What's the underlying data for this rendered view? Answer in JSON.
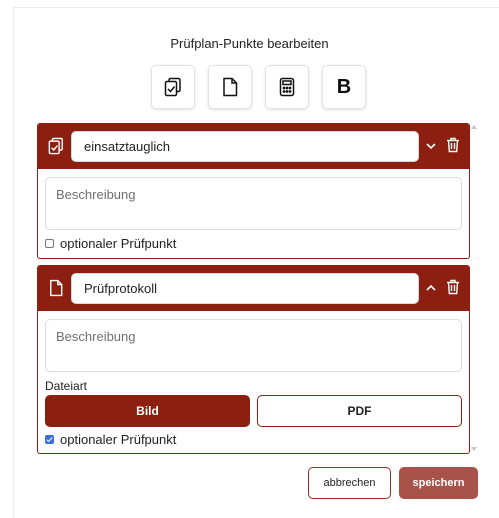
{
  "dialog": {
    "title": "Prüfplan-Punkte bearbeiten"
  },
  "toolbar": {
    "buttons": [
      {
        "icon": "clipboard-check-icon"
      },
      {
        "icon": "file-icon"
      },
      {
        "icon": "calculator-icon"
      },
      {
        "icon": "bold-icon",
        "label": "B"
      }
    ]
  },
  "items": [
    {
      "icon": "clipboard-check-icon",
      "name": "einsatztauglich",
      "expanded": false,
      "description_placeholder": "Beschreibung",
      "optional_label": "optionaler Prüfpunkt",
      "optional_checked": false
    },
    {
      "icon": "file-icon",
      "name": "Prüfprotokoll",
      "expanded": true,
      "description_placeholder": "Beschreibung",
      "file_type_label": "Dateiart",
      "file_type_options": [
        "Bild",
        "PDF"
      ],
      "file_type_selected": "Bild",
      "optional_label": "optionaler Prüfpunkt",
      "optional_checked": true
    }
  ],
  "footer": {
    "cancel_label": "abbrechen",
    "save_label": "speichern"
  },
  "colors": {
    "accent": "#8c1f10",
    "save_button": "#a9524a",
    "checkbox": "#3b6fd4"
  }
}
